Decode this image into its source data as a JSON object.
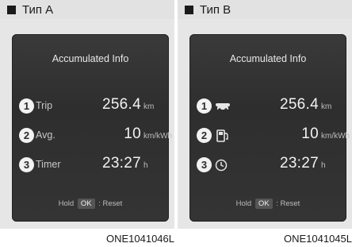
{
  "panels": [
    {
      "title": "Тип A",
      "screen_title": "Accumulated Info",
      "rows": [
        {
          "num": "1",
          "label": "Trip",
          "value": "256.4",
          "unit": "km"
        },
        {
          "num": "2",
          "label": "Avg.",
          "value": "10",
          "unit": "km/kWh"
        },
        {
          "num": "3",
          "label": "Timer",
          "value": "23:27",
          "unit": "h"
        }
      ],
      "hold": {
        "hold": "Hold",
        "ok": "OK",
        "reset": ": Reset"
      },
      "code": "ONE1041046L"
    },
    {
      "title": "Тип B",
      "screen_title": "Accumulated Info",
      "rows": [
        {
          "num": "1",
          "icon": "car-trip-icon",
          "value": "256.4",
          "unit": "km"
        },
        {
          "num": "2",
          "icon": "fuel-pump-icon",
          "value": "10",
          "unit": "km/kWh"
        },
        {
          "num": "3",
          "icon": "clock-icon",
          "value": "23:27",
          "unit": "h"
        }
      ],
      "hold": {
        "hold": "Hold",
        "ok": "OK",
        "reset": ": Reset"
      },
      "code": "ONE1041045L"
    }
  ]
}
